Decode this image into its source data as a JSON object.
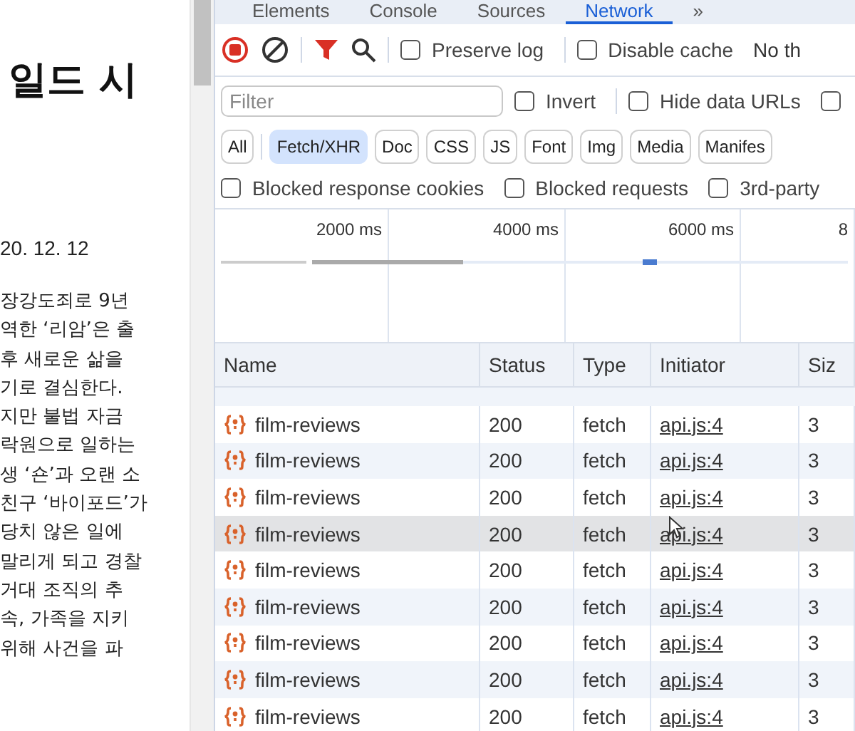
{
  "page": {
    "title": "일드 시",
    "date": "20. 12. 12",
    "lines": [
      "장강도죄로 9년",
      "역한 ‘리암’은 출",
      "후 새로운 삶을",
      "기로 결심한다.",
      "지만 불법 자금",
      "락원으로 일하는",
      "생 ‘숀’과 오랜 소",
      "친구 ‘바이포드’가",
      "당치 않은 일에",
      "말리게 되고 경찰",
      "거대 조직의 추",
      "속, 가족을 지키",
      "위해 사건을 파"
    ]
  },
  "devtools": {
    "tabs": [
      {
        "label": "Elements",
        "selected": false
      },
      {
        "label": "Console",
        "selected": false
      },
      {
        "label": "Sources",
        "selected": false
      },
      {
        "label": "Network",
        "selected": true
      },
      {
        "label": "»",
        "selected": false
      }
    ],
    "toolbar": {
      "preserve_log": {
        "label": "Preserve log",
        "checked": false
      },
      "disable_cache": {
        "label": "Disable cache",
        "checked": false
      },
      "throttling": "No th"
    },
    "filter": {
      "placeholder": "Filter",
      "invert": {
        "label": "Invert",
        "checked": false
      },
      "hide_data_urls": {
        "label": "Hide data URLs",
        "checked": false
      },
      "more": {
        "checked": false
      }
    },
    "type_filters": [
      {
        "label": "All",
        "selected": false
      },
      {
        "label": "Fetch/XHR",
        "selected": true
      },
      {
        "label": "Doc",
        "selected": false
      },
      {
        "label": "CSS",
        "selected": false
      },
      {
        "label": "JS",
        "selected": false
      },
      {
        "label": "Font",
        "selected": false
      },
      {
        "label": "Img",
        "selected": false
      },
      {
        "label": "Media",
        "selected": false
      },
      {
        "label": "Manifes",
        "selected": false
      }
    ],
    "blocked": [
      {
        "label": "Blocked response cookies",
        "checked": false
      },
      {
        "label": "Blocked requests",
        "checked": false
      },
      {
        "label": "3rd-party",
        "checked": false
      }
    ],
    "overview": {
      "ticks": [
        "2000 ms",
        "4000 ms",
        "6000 ms",
        "8"
      ]
    },
    "table": {
      "columns": [
        "Name",
        "Status",
        "Type",
        "Initiator",
        "Siz"
      ],
      "rows": [
        {
          "name": "film-reviews",
          "status": "200",
          "type": "fetch",
          "initiator": "api.js:4",
          "size": "3",
          "hovered": false
        },
        {
          "name": "film-reviews",
          "status": "200",
          "type": "fetch",
          "initiator": "api.js:4",
          "size": "3",
          "hovered": false
        },
        {
          "name": "film-reviews",
          "status": "200",
          "type": "fetch",
          "initiator": "api.js:4",
          "size": "3",
          "hovered": false
        },
        {
          "name": "film-reviews",
          "status": "200",
          "type": "fetch",
          "initiator": "api.js:4",
          "size": "3",
          "hovered": true
        },
        {
          "name": "film-reviews",
          "status": "200",
          "type": "fetch",
          "initiator": "api.js:4",
          "size": "3",
          "hovered": false
        },
        {
          "name": "film-reviews",
          "status": "200",
          "type": "fetch",
          "initiator": "api.js:4",
          "size": "3",
          "hovered": false
        },
        {
          "name": "film-reviews",
          "status": "200",
          "type": "fetch",
          "initiator": "api.js:4",
          "size": "3",
          "hovered": false
        },
        {
          "name": "film-reviews",
          "status": "200",
          "type": "fetch",
          "initiator": "api.js:4",
          "size": "3",
          "hovered": false
        },
        {
          "name": "film-reviews",
          "status": "200",
          "type": "fetch",
          "initiator": "api.js:4",
          "size": "3",
          "hovered": false
        }
      ]
    }
  }
}
